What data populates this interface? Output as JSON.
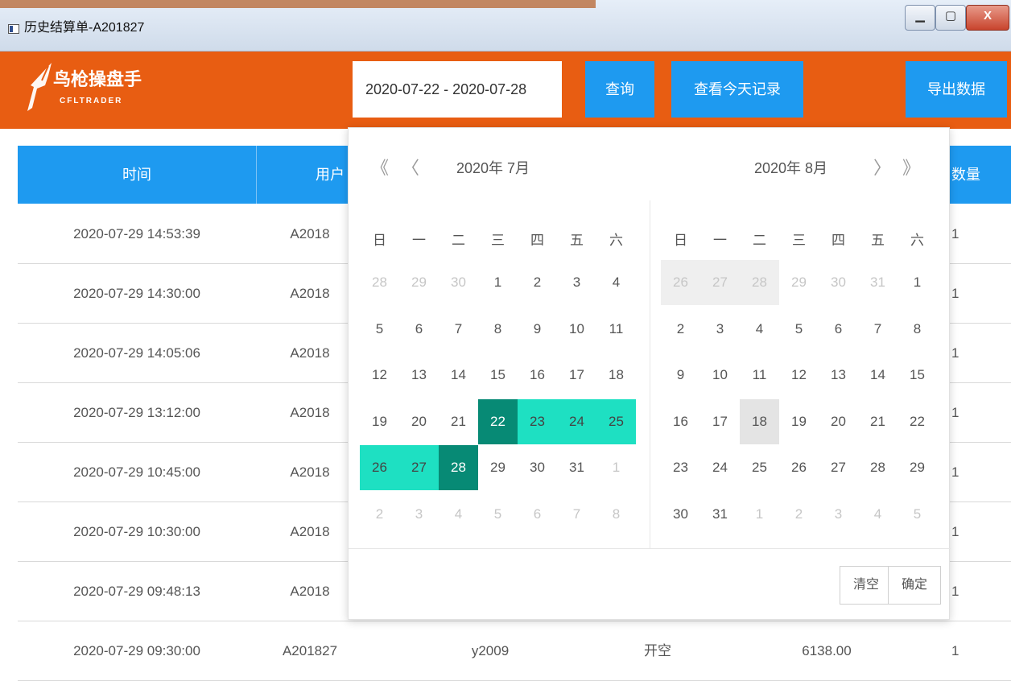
{
  "window": {
    "title": "历史结算单-A201827",
    "min_label": "▁",
    "max_label": "▢",
    "close_label": "X"
  },
  "header": {
    "logo_title": "鸟枪操盘手",
    "logo_sub": "CFLTRADER",
    "date_range_value": "2020-07-22 - 2020-07-28",
    "query_label": "查询",
    "today_label": "查看今天记录",
    "export_label": "导出数据"
  },
  "table": {
    "headers": {
      "time": "时间",
      "user": "用户",
      "qty": "数量"
    },
    "rows": [
      {
        "time": "2020-07-29 14:53:39",
        "user": "A2018",
        "code": "",
        "dir": "",
        "price": "",
        "qty": "1"
      },
      {
        "time": "2020-07-29 14:30:00",
        "user": "A2018",
        "code": "",
        "dir": "",
        "price": "",
        "qty": "1"
      },
      {
        "time": "2020-07-29 14:05:06",
        "user": "A2018",
        "code": "",
        "dir": "",
        "price": "",
        "qty": "1"
      },
      {
        "time": "2020-07-29 13:12:00",
        "user": "A2018",
        "code": "",
        "dir": "",
        "price": "",
        "qty": "1"
      },
      {
        "time": "2020-07-29 10:45:00",
        "user": "A2018",
        "code": "",
        "dir": "",
        "price": "",
        "qty": "1"
      },
      {
        "time": "2020-07-29 10:30:00",
        "user": "A2018",
        "code": "",
        "dir": "",
        "price": "",
        "qty": "1"
      },
      {
        "time": "2020-07-29 09:48:13",
        "user": "A2018",
        "code": "",
        "dir": "",
        "price": "",
        "qty": "1"
      },
      {
        "time": "2020-07-29 09:30:00",
        "user": "A201827",
        "code": "y2009",
        "dir": "开空",
        "price": "6138.00",
        "qty": "1"
      }
    ]
  },
  "picker": {
    "nav": {
      "prev_year": "《",
      "prev_month": "〈",
      "next_month": "〉",
      "next_year": "》"
    },
    "weekdays": [
      "日",
      "一",
      "二",
      "三",
      "四",
      "五",
      "六"
    ],
    "left": {
      "title": "2020年 7月",
      "weeks": [
        [
          [
            "28",
            "off"
          ],
          [
            "29",
            "off"
          ],
          [
            "30",
            "off"
          ],
          [
            "1",
            ""
          ],
          [
            "2",
            ""
          ],
          [
            "3",
            ""
          ],
          [
            "4",
            ""
          ]
        ],
        [
          [
            "5",
            ""
          ],
          [
            "6",
            ""
          ],
          [
            "7",
            ""
          ],
          [
            "8",
            ""
          ],
          [
            "9",
            ""
          ],
          [
            "10",
            ""
          ],
          [
            "11",
            ""
          ]
        ],
        [
          [
            "12",
            ""
          ],
          [
            "13",
            ""
          ],
          [
            "14",
            ""
          ],
          [
            "15",
            ""
          ],
          [
            "16",
            ""
          ],
          [
            "17",
            ""
          ],
          [
            "18",
            ""
          ]
        ],
        [
          [
            "19",
            ""
          ],
          [
            "20",
            ""
          ],
          [
            "21",
            ""
          ],
          [
            "22",
            "sel"
          ],
          [
            "23",
            "range"
          ],
          [
            "24",
            "range"
          ],
          [
            "25",
            "range"
          ]
        ],
        [
          [
            "26",
            "range"
          ],
          [
            "27",
            "range"
          ],
          [
            "28",
            "sel"
          ],
          [
            "29",
            ""
          ],
          [
            "30",
            ""
          ],
          [
            "31",
            ""
          ],
          [
            "1",
            "off"
          ]
        ],
        [
          [
            "2",
            "off"
          ],
          [
            "3",
            "off"
          ],
          [
            "4",
            "off"
          ],
          [
            "5",
            "off"
          ],
          [
            "6",
            "off"
          ],
          [
            "7",
            "off"
          ],
          [
            "8",
            "off"
          ]
        ]
      ]
    },
    "right": {
      "title": "2020年 8月",
      "weeks": [
        [
          [
            "26",
            "off grey"
          ],
          [
            "27",
            "off grey"
          ],
          [
            "28",
            "off grey"
          ],
          [
            "29",
            "off"
          ],
          [
            "30",
            "off"
          ],
          [
            "31",
            "off"
          ],
          [
            "1",
            ""
          ]
        ],
        [
          [
            "2",
            ""
          ],
          [
            "3",
            ""
          ],
          [
            "4",
            ""
          ],
          [
            "5",
            ""
          ],
          [
            "6",
            ""
          ],
          [
            "7",
            ""
          ],
          [
            "8",
            ""
          ]
        ],
        [
          [
            "9",
            ""
          ],
          [
            "10",
            ""
          ],
          [
            "11",
            ""
          ],
          [
            "12",
            ""
          ],
          [
            "13",
            ""
          ],
          [
            "14",
            ""
          ],
          [
            "15",
            ""
          ]
        ],
        [
          [
            "16",
            ""
          ],
          [
            "17",
            ""
          ],
          [
            "18",
            "hl"
          ],
          [
            "19",
            ""
          ],
          [
            "20",
            ""
          ],
          [
            "21",
            ""
          ],
          [
            "22",
            ""
          ]
        ],
        [
          [
            "23",
            ""
          ],
          [
            "24",
            ""
          ],
          [
            "25",
            ""
          ],
          [
            "26",
            ""
          ],
          [
            "27",
            ""
          ],
          [
            "28",
            ""
          ],
          [
            "29",
            ""
          ]
        ],
        [
          [
            "30",
            ""
          ],
          [
            "31",
            ""
          ],
          [
            "1",
            "off"
          ],
          [
            "2",
            "off"
          ],
          [
            "3",
            "off"
          ],
          [
            "4",
            "off"
          ],
          [
            "5",
            "off"
          ]
        ]
      ]
    },
    "clear_label": "清空",
    "confirm_label": "确定"
  }
}
